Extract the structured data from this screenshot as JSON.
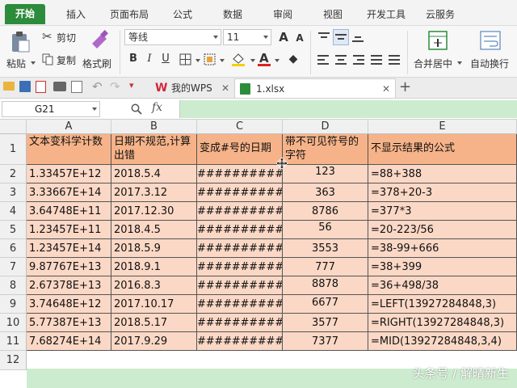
{
  "menu": {
    "tabs": [
      "开始",
      "插入",
      "页面布局",
      "公式",
      "数据",
      "审阅",
      "视图",
      "开发工具",
      "云服务"
    ],
    "active_index": 0
  },
  "ribbon": {
    "paste": "粘贴",
    "cut": "剪切",
    "copy": "复制",
    "format_painter": "格式刷",
    "font_name": "等线",
    "font_size": "11",
    "merge_center": "合并居中",
    "wrap_text": "自动换行",
    "bold": "B",
    "italic": "I",
    "underline": "U",
    "font_color_letter": "A",
    "grow_font": "A",
    "shrink_font": "A"
  },
  "doc_tabs": {
    "wps_tab": "我的WPS",
    "file_tab": "1.xlsx"
  },
  "formula_bar": {
    "cell_ref": "G21",
    "fx": "fx",
    "formula": ""
  },
  "sheet": {
    "columns": [
      "A",
      "B",
      "C",
      "D",
      "E"
    ],
    "rows": [
      "1",
      "2",
      "3",
      "4",
      "5",
      "6",
      "7",
      "8",
      "9",
      "10",
      "11",
      "12"
    ],
    "headers": [
      "文本变科学计数",
      "日期不规范,计算出错",
      "变成#号的日期",
      "带不可见符号的字符",
      "不显示结果的公式"
    ],
    "data": [
      [
        "1.33457E+12",
        "2018.5.4",
        "############",
        "123",
        "=88+388"
      ],
      [
        "3.33667E+14",
        "2017.3.12",
        "############",
        "363",
        "=378+20-3"
      ],
      [
        "3.64748E+11",
        "2017.12.30",
        "############",
        "8786",
        "=377*3"
      ],
      [
        "1.23457E+11",
        "2018.4.5",
        "############",
        "56",
        "=20-223/56"
      ],
      [
        "1.23457E+14",
        "2018.5.9",
        "############",
        "3553",
        "=38-99+666"
      ],
      [
        "9.87767E+13",
        "2018.9.1",
        "############",
        "777",
        "=38+399"
      ],
      [
        "2.67378E+13",
        "2016.8.3",
        "############",
        "8878",
        "=36+498/38"
      ],
      [
        "3.74648E+12",
        "2017.10.17",
        "############",
        "6677",
        "=LEFT(13927284848,3)"
      ],
      [
        "5.77387E+13",
        "2018.5.17",
        "############",
        "3577",
        "=RIGHT(13927284848,3)"
      ],
      [
        "7.68274E+14",
        "2017.9.29",
        "############",
        "7377",
        "=MID(13927284848,3,4)"
      ]
    ]
  },
  "watermark": "头条号 / 解晴新生",
  "colors": {
    "accent": "#2d8c3c",
    "header_fill": "#f6b389",
    "data_fill": "#fbd8c6",
    "row12_fill": "#cdeccf"
  }
}
